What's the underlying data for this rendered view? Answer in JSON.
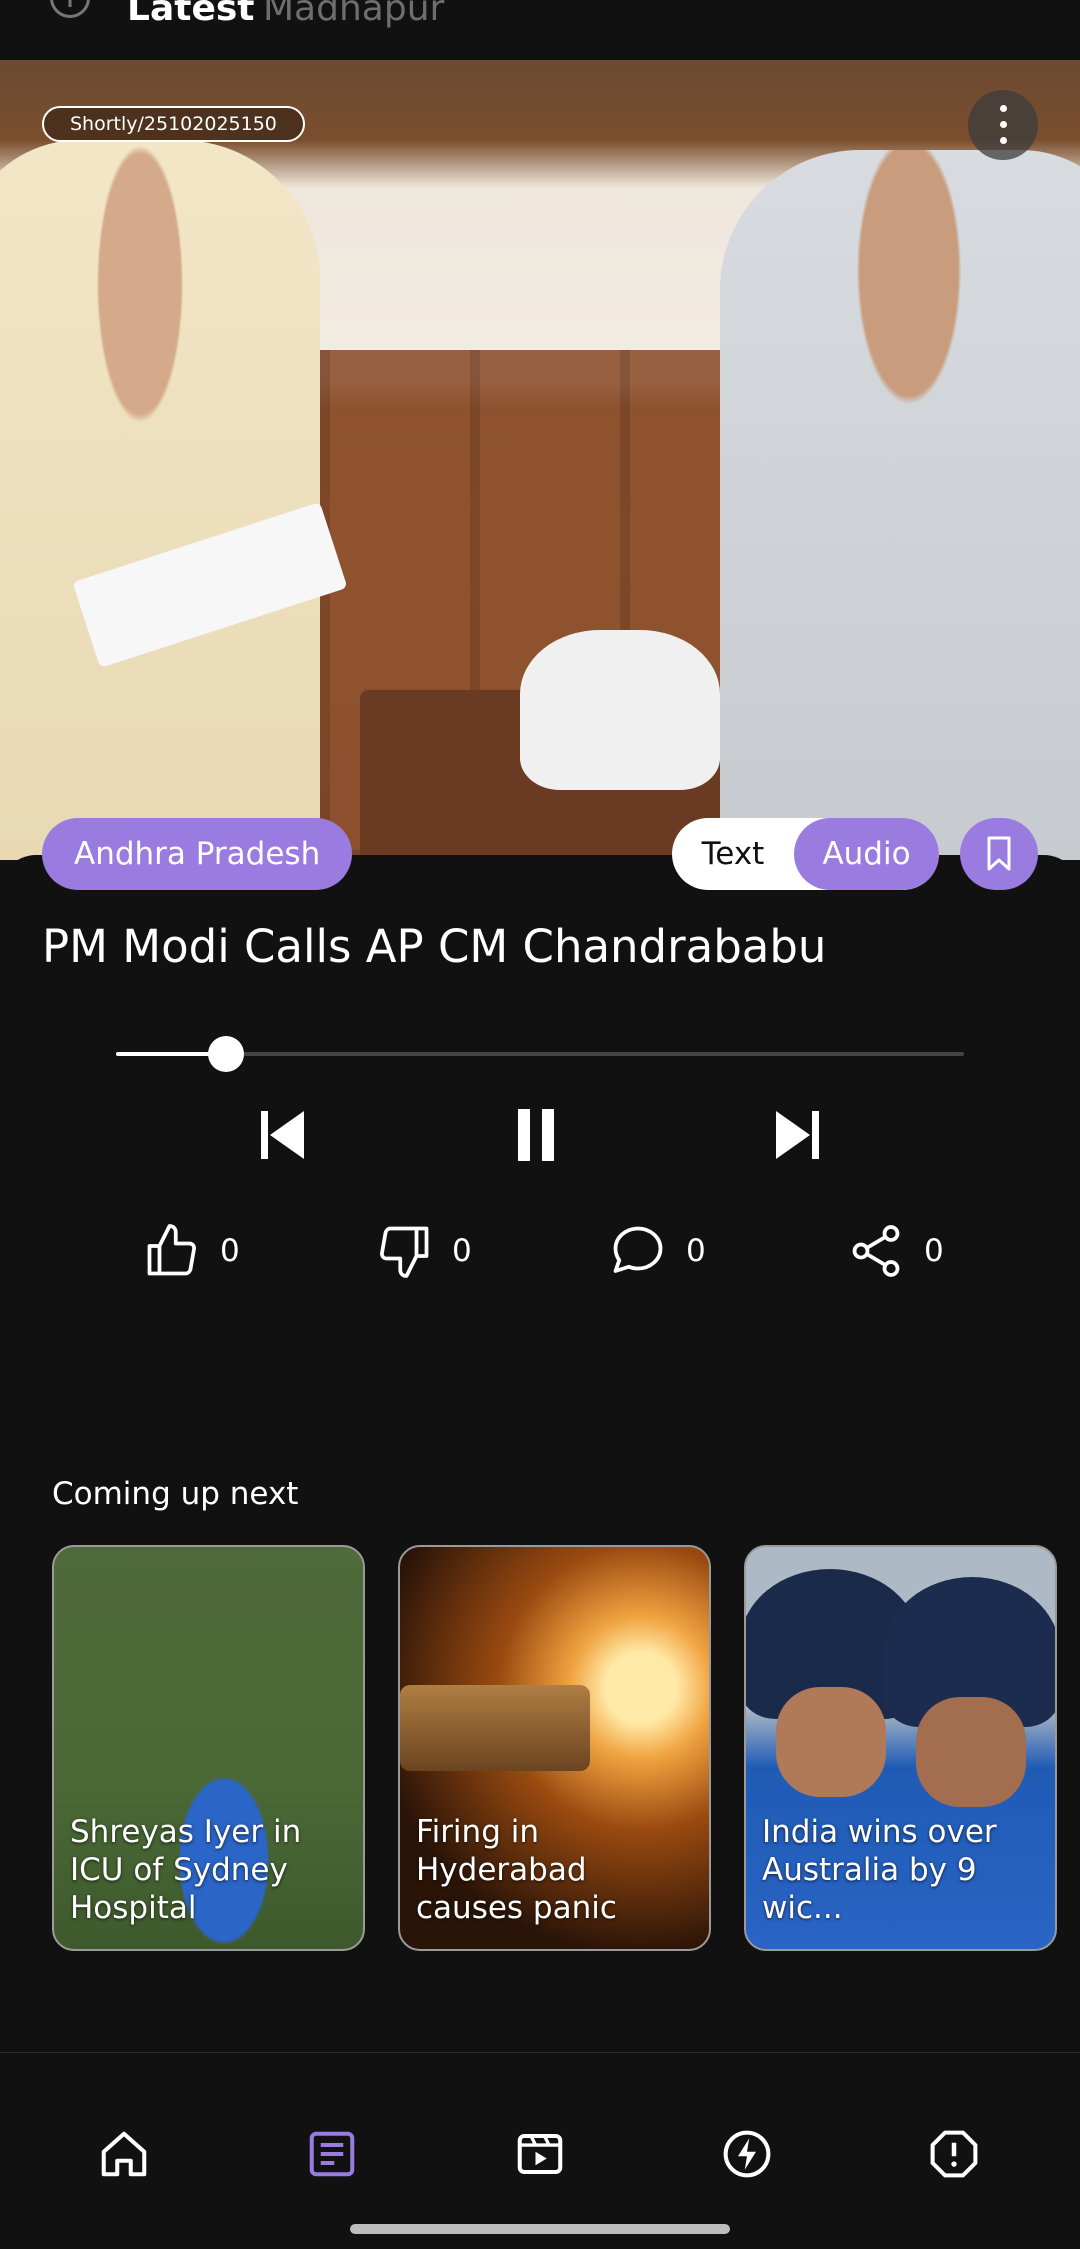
{
  "topbar": {
    "tabs": [
      {
        "label": "Latest"
      },
      {
        "label": "Madhapur"
      }
    ]
  },
  "hero": {
    "badge": "Shortly/25102025150",
    "image_alt": "photo-two-politicians-meeting"
  },
  "article": {
    "category": "Andhra Pradesh",
    "mode_text": "Text",
    "mode_audio": "Audio",
    "headline": "PM Modi Calls AP CM Chandrababu",
    "audio_progress": 0.13
  },
  "reactions": {
    "likes": "0",
    "dislikes": "0",
    "comments": "0",
    "shares": "0"
  },
  "up_next": {
    "title": "Coming up next",
    "cards": [
      {
        "caption": "Shreyas Iyer in ICU of Sydney Hospital"
      },
      {
        "caption": "Firing in Hyderabad causes panic"
      },
      {
        "caption": "India wins over Australia by 9 wic..."
      }
    ]
  },
  "colors": {
    "accent": "#9a7be0",
    "background": "#111112"
  },
  "nav": {
    "items": [
      "home-icon",
      "articles-icon",
      "video-icon",
      "shorts-icon",
      "alert-icon"
    ],
    "active": "articles-icon"
  }
}
